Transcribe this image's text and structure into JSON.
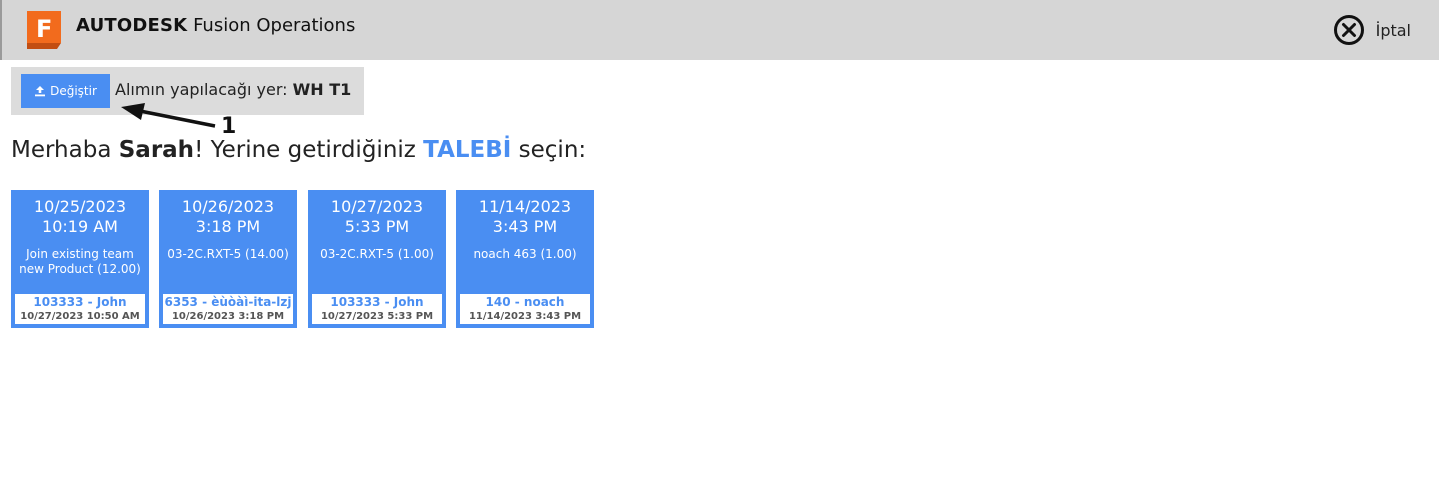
{
  "header": {
    "brand_bold": "AUTODESK",
    "brand_rest": "Fusion Operations",
    "logo_letter": "F",
    "cancel_label": "İptal",
    "cancel_icon": "close-circle-icon"
  },
  "location": {
    "change_label": "Değiştir",
    "change_icon": "upload-icon",
    "text_prefix": "Alımın yapılacağı yer:",
    "value": "WH T1"
  },
  "annotation": {
    "number": "1"
  },
  "greeting": {
    "hello": "Merhaba",
    "name": "Sarah",
    "middle": "! Yerine getirdiğiniz",
    "highlight": "TALEBİ",
    "end": "seçin:"
  },
  "requests": [
    {
      "date": "10/25/2023",
      "time": "10:19 AM",
      "item": "Join existing team new Product (12.00)",
      "who": "103333 - John",
      "timestamp": "10/27/2023 10:50 AM"
    },
    {
      "date": "10/26/2023",
      "time": "3:18 PM",
      "item": "03-2C.RXT-5 (14.00)",
      "who": "6353 - èùòàì-ita-lzj",
      "timestamp": "10/26/2023 3:18 PM"
    },
    {
      "date": "10/27/2023",
      "time": "5:33 PM",
      "item": "03-2C.RXT-5 (1.00)",
      "who": "103333 - John",
      "timestamp": "10/27/2023 5:33 PM"
    },
    {
      "date": "11/14/2023",
      "time": "3:43 PM",
      "item": "noach 463 (1.00)",
      "who": "140 - noach",
      "timestamp": "11/14/2023 3:43 PM"
    }
  ],
  "colors": {
    "accent": "#4a8ef2",
    "logo_orange": "#f26b1d",
    "header_bg": "#d6d6d6"
  }
}
